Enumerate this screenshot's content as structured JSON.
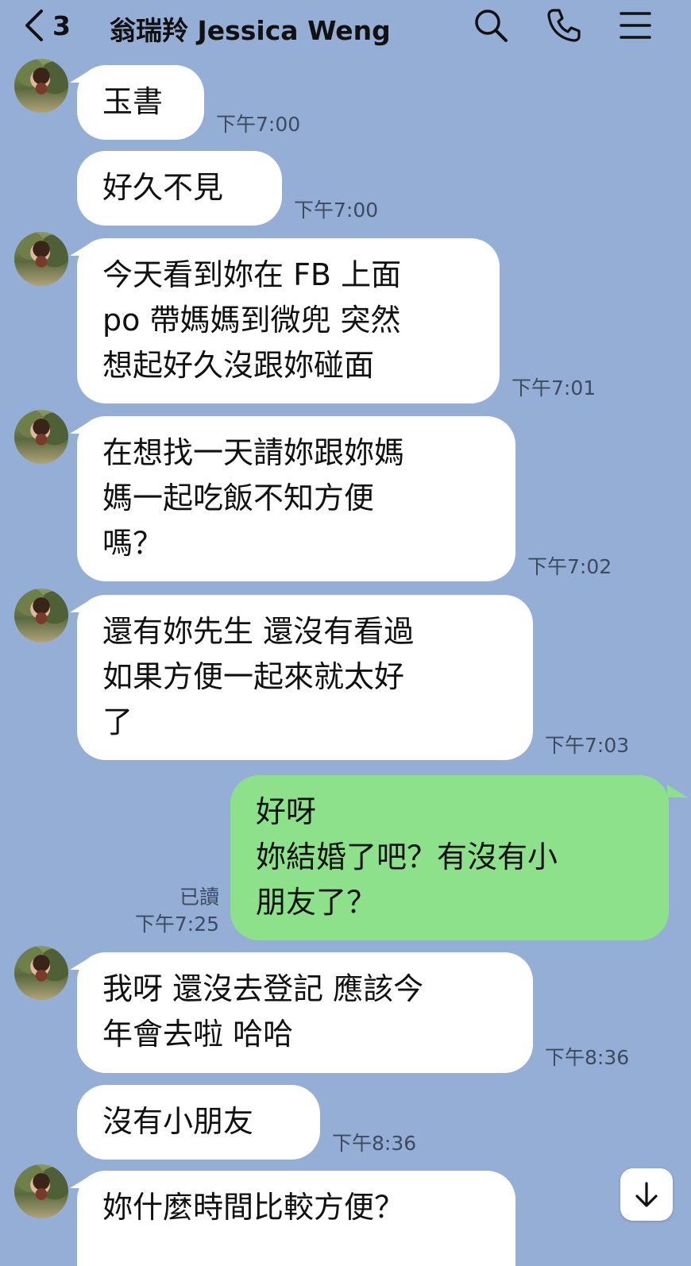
{
  "header": {
    "unread_count": "3",
    "contact_name": "翁瑞羚 Jessica Weng"
  },
  "messages": [
    {
      "text": "玉書",
      "time": "下午7:00"
    },
    {
      "text": "好久不見",
      "time": "下午7:00"
    },
    {
      "lines": [
        "今天看到妳在 FB 上面",
        "po 帶媽媽到微兜 突然",
        "想起好久沒跟妳碰面"
      ],
      "time": "下午7:01"
    },
    {
      "lines": [
        "在想找一天請妳跟妳媽",
        "媽一起吃飯不知方便",
        "嗎？"
      ],
      "time": "下午7:02"
    },
    {
      "lines": [
        "還有妳先生 還沒有看過",
        "如果方便一起來就太好",
        "了"
      ],
      "time": "下午7:03"
    },
    {
      "lines": [
        "好呀",
        "妳結婚了吧？有沒有小",
        "朋友了？"
      ],
      "read": "已讀",
      "time": "下午7:25"
    },
    {
      "lines": [
        "我呀 還沒去登記 應該今",
        "年會去啦 哈哈"
      ],
      "time": "下午8:36"
    },
    {
      "text": "沒有小朋友",
      "time": "下午8:36"
    },
    {
      "text": "妳什麼時間比較方便？"
    }
  ]
}
